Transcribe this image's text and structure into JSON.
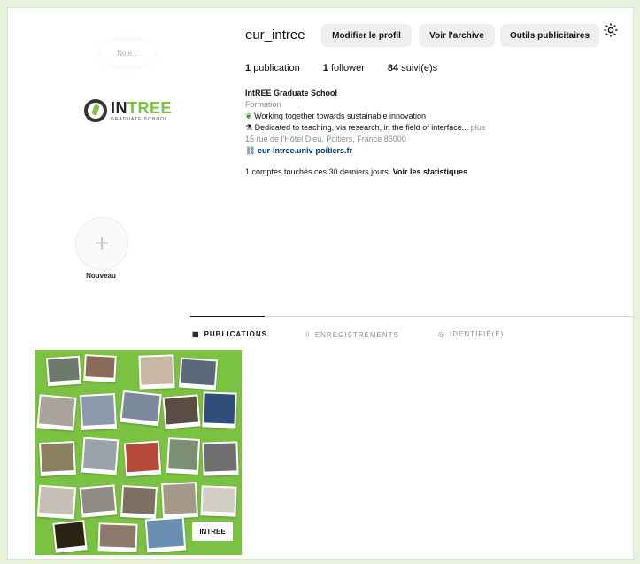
{
  "profile": {
    "note_placeholder": "Note...",
    "username": "eur_intree",
    "logo": {
      "main_in": "IN",
      "main_tree": "TREE",
      "sub": "GRADUATE SCHOOL"
    }
  },
  "actions": {
    "edit_profile": "Modifier le profil",
    "view_archive": "Voir l'archive",
    "ad_tools": "Outils publicitaires"
  },
  "stats": {
    "publications_count": "1",
    "publications_label": "publication",
    "followers_count": "1",
    "followers_label": "follower",
    "following_count": "84",
    "following_label": "suivi(e)s"
  },
  "bio": {
    "name": "IntREE Graduate School",
    "category": "Formation",
    "line1": "Working together towards sustainable innovation",
    "line2": "Dedicated to teaching, via research, in the field of interface...",
    "more": "plus",
    "address": "15 rue de l'Hôtel Dieu, Poitiers, France 86000",
    "link": "eur-intree.univ-poitiers.fr"
  },
  "insights": {
    "text": "1 comptes touchés ces 30 derniers jours.",
    "link": "Voir les statistiques"
  },
  "highlights": {
    "new_label": "Nouveau"
  },
  "tabs": [
    {
      "label": "PUBLICATIONS",
      "icon": "grid-icon"
    },
    {
      "label": "ENREGISTREMENTS",
      "icon": "bookmark-icon"
    },
    {
      "label": "IDENTIFIÉ(E)",
      "icon": "tag-icon"
    }
  ],
  "post": {
    "logo_text": "INTREE"
  },
  "colors": {
    "brand_green": "#7cc242",
    "link_blue": "#00376b",
    "muted": "#8e8e8e"
  }
}
